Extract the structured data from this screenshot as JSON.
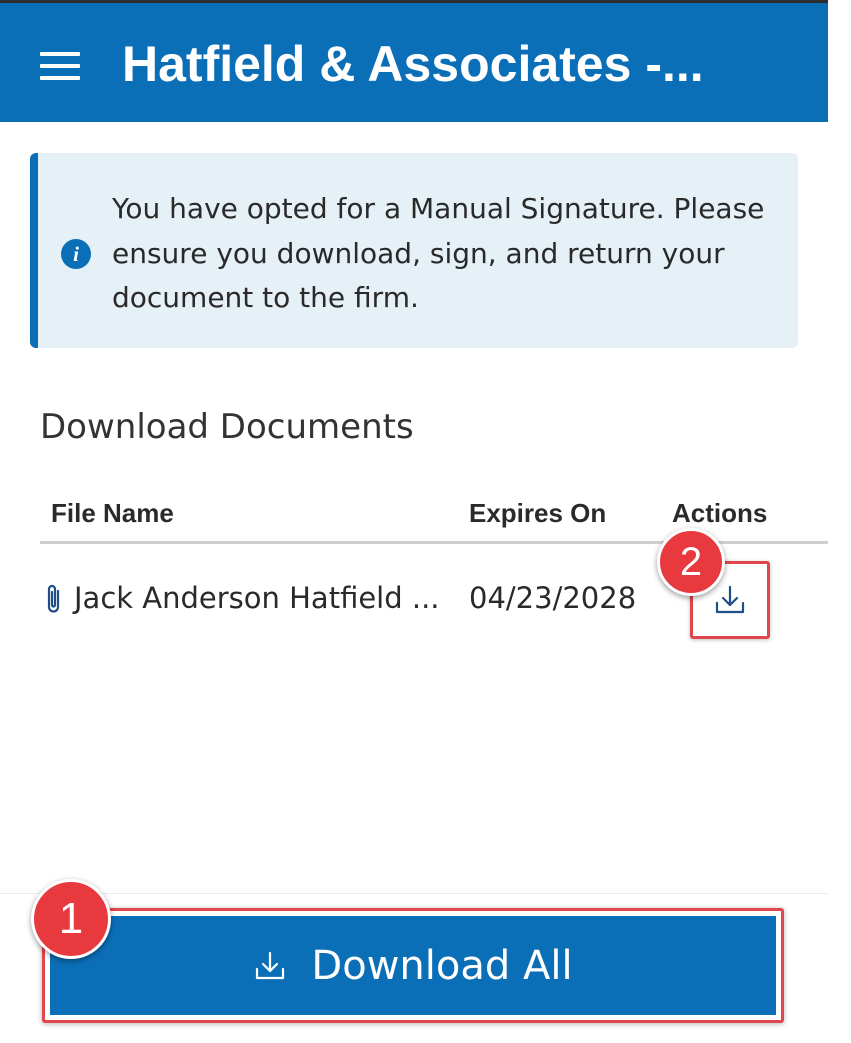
{
  "header": {
    "title": "Hatfield & Associates -..."
  },
  "banner": {
    "message": "You have opted for a Manual Signature. Please ensure you download, sign, and return your document to the firm."
  },
  "documents": {
    "section_title": "Download Documents",
    "columns": {
      "file_name": "File Name",
      "expires_on": "Expires On",
      "actions": "Actions"
    },
    "rows": [
      {
        "file_name": "Jack Anderson Hatfield ...",
        "expires_on": "04/23/2028"
      }
    ]
  },
  "annotations": {
    "step_1": "1",
    "step_2": "2"
  },
  "footer": {
    "download_all_label": "Download All"
  },
  "colors": {
    "brand_blue": "#0b6fb8",
    "banner_bg": "#e6f0f7",
    "highlight_red": "#e0474c"
  }
}
